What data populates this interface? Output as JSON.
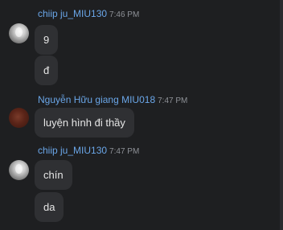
{
  "messages": [
    {
      "sender": "chiip ju_MIU130",
      "time": "7:46 PM",
      "bubbles": [
        "9",
        "đ"
      ]
    },
    {
      "sender": "Nguyễn Hữu giang MIU018",
      "time": "7:47 PM",
      "bubbles": [
        "luyện hình đi thầy"
      ]
    },
    {
      "sender": "chiip ju_MIU130",
      "time": "7:47 PM",
      "bubbles": [
        "chín",
        "da"
      ]
    }
  ],
  "icons": {
    "avatar_1": "avatar-chiip-ju",
    "avatar_2": "avatar-nguyen-huu-giang",
    "avatar_3": "avatar-chiip-ju"
  },
  "colors": {
    "background": "#1e1f21",
    "bubble": "#2f3033",
    "sender": "#6aa6e8",
    "timestamp": "#8e9197",
    "text": "#e6e6e6"
  }
}
